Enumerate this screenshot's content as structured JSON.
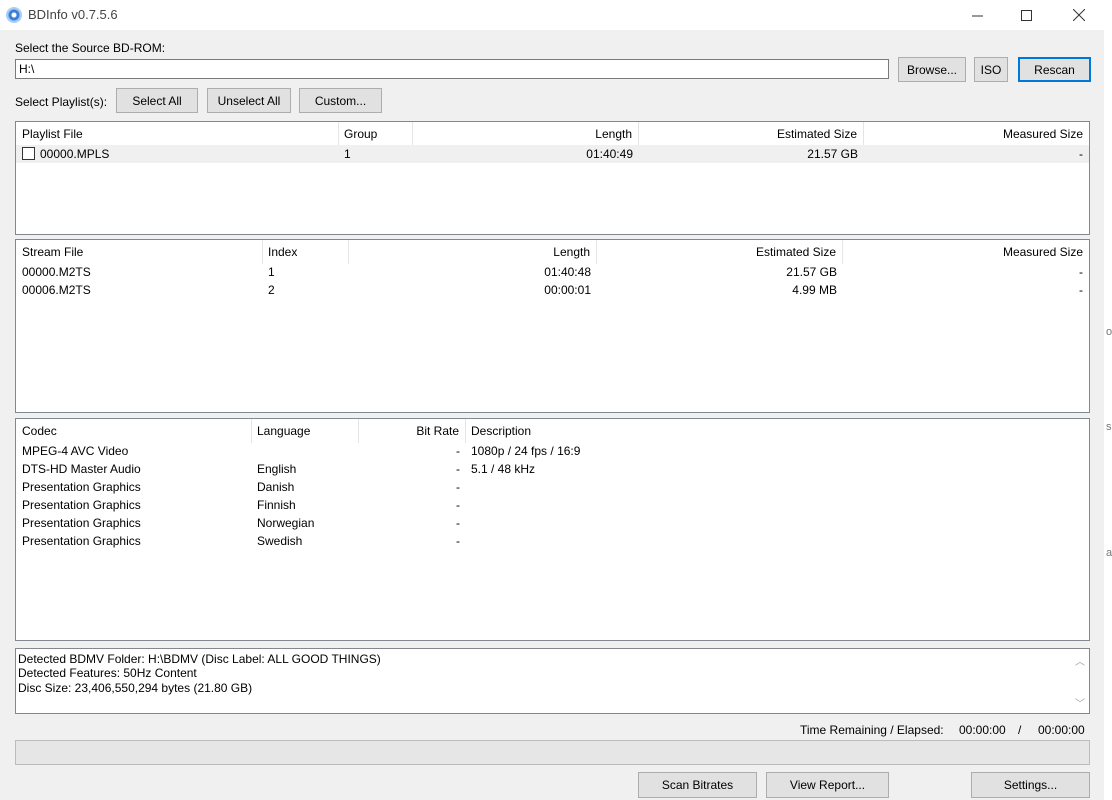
{
  "window": {
    "title": "BDInfo v0.7.5.6",
    "controls": {
      "minimize": "—",
      "maximize": "☐",
      "close": "✕"
    }
  },
  "source": {
    "label": "Select the Source BD-ROM:",
    "path": "H:\\",
    "browse": "Browse...",
    "iso": "ISO",
    "rescan": "Rescan"
  },
  "playlist_select": {
    "label": "Select Playlist(s):",
    "select_all": "Select All",
    "unselect_all": "Unselect All",
    "custom": "Custom..."
  },
  "playlists": {
    "columns": [
      "Playlist File",
      "Group",
      "Length",
      "Estimated Size",
      "Measured Size"
    ],
    "rows": [
      {
        "file": "00000.MPLS",
        "group": "1",
        "length": "01:40:49",
        "estimated": "21.57 GB",
        "measured": "-"
      }
    ]
  },
  "streams": {
    "columns": [
      "Stream File",
      "Index",
      "Length",
      "Estimated Size",
      "Measured Size"
    ],
    "rows": [
      {
        "file": "00000.M2TS",
        "index": "1",
        "length": "01:40:48",
        "estimated": "21.57 GB",
        "measured": "-"
      },
      {
        "file": "00006.M2TS",
        "index": "2",
        "length": "00:00:01",
        "estimated": "4.99 MB",
        "measured": "-"
      }
    ]
  },
  "codecs": {
    "columns": [
      "Codec",
      "Language",
      "Bit Rate",
      "Description"
    ],
    "rows": [
      {
        "codec": "MPEG-4 AVC Video",
        "language": "",
        "bitrate": "-",
        "description": "1080p / 24 fps / 16:9"
      },
      {
        "codec": "DTS-HD Master Audio",
        "language": "English",
        "bitrate": "-",
        "description": "5.1 / 48 kHz"
      },
      {
        "codec": "Presentation Graphics",
        "language": "Danish",
        "bitrate": "-",
        "description": ""
      },
      {
        "codec": "Presentation Graphics",
        "language": "Finnish",
        "bitrate": "-",
        "description": ""
      },
      {
        "codec": "Presentation Graphics",
        "language": "Norwegian",
        "bitrate": "-",
        "description": ""
      },
      {
        "codec": "Presentation Graphics",
        "language": "Swedish",
        "bitrate": "-",
        "description": ""
      }
    ]
  },
  "report": {
    "lines": [
      "Detected BDMV Folder: H:\\BDMV (Disc Label: ALL GOOD THINGS)",
      "Detected Features: 50Hz Content",
      "Disc Size: 23,406,550,294 bytes (21.80 GB)"
    ],
    "scroll_up": "︿",
    "scroll_down": "﹀"
  },
  "status": {
    "label": "Time Remaining / Elapsed:",
    "remaining": "00:00:00",
    "separator": "/",
    "elapsed": "00:00:00",
    "progress": 0
  },
  "bottom_buttons": {
    "scan_bitrates": "Scan Bitrates",
    "view_report": "View Report...",
    "settings": "Settings..."
  },
  "edge_marks": [
    "o",
    "s",
    "a"
  ]
}
